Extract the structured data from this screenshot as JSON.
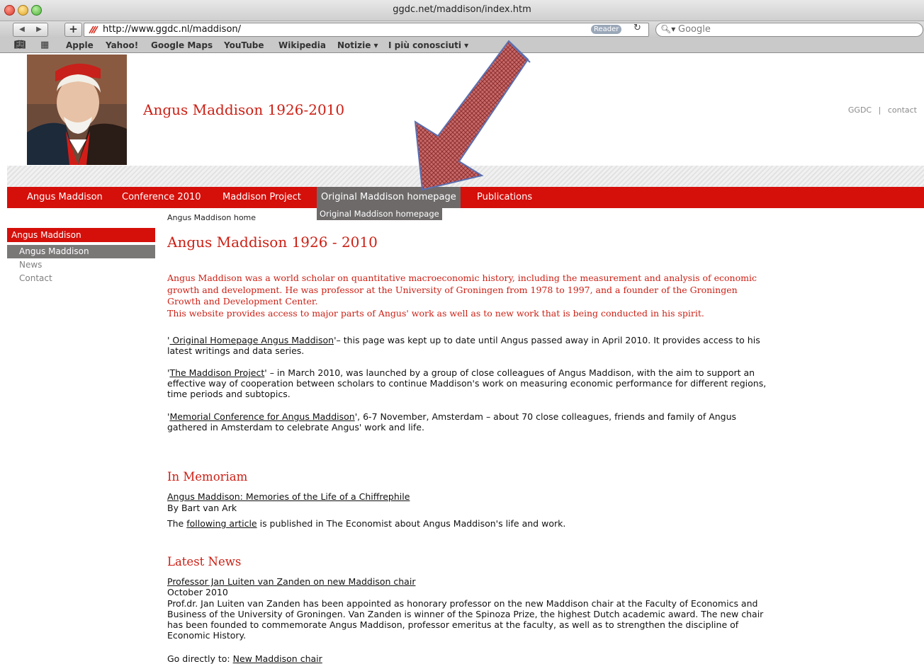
{
  "browser": {
    "window_title": "ggdc.net/maddison/index.htm",
    "url": "http://www.ggdc.nl/maddison/",
    "reader_label": "Reader",
    "search_placeholder": "Google",
    "bookmarks": [
      "Apple",
      "Yahoo!",
      "Google Maps",
      "YouTube",
      "Wikipedia",
      "Notizie ▾",
      "I più conosciuti ▾"
    ]
  },
  "header": {
    "site_title": "Angus Maddison 1926-2010",
    "top_links": [
      "GGDC",
      "contact"
    ],
    "separator": "|"
  },
  "nav": {
    "items": [
      "Angus Maddison",
      "Conference 2010",
      "Maddison Project",
      "Original Maddison homepage",
      "Publications"
    ],
    "active_submenu": "Original Maddison homepage"
  },
  "sidebar": {
    "heading": "Angus Maddison",
    "active_item": "Angus Maddison",
    "items": [
      "News",
      "Contact"
    ]
  },
  "main": {
    "breadcrumb": "Angus Maddison home",
    "title": "Angus Maddison 1926 - 2010",
    "intro_1": "Angus Maddison was a world scholar on quantitative macroeconomic history, including the measurement and analysis of economic growth and development. He was professor at the University of Groningen from 1978 to 1997, and a founder of the Groningen Growth and Development Center.",
    "intro_2": "This website provides access to major parts of Angus' work as well as to new work that is being conducted in his spirit.",
    "p1_link": " Original Homepage Angus Maddison",
    "p1_text": "– this page was kept up to date until Angus passed away in April 2010. It provides access to his latest writings and data series.",
    "p2_link": "The Maddison Project",
    "p2_text": " – in March 2010, was launched by a group of close colleagues of Angus Maddison, with the aim to support an effective way of cooperation between scholars to continue Maddison's work on measuring economic performance for different regions, time periods and subtopics.",
    "p3_link": "Memorial Conference for Angus Maddison",
    "p3_text": ", 6-7 November, Amsterdam – about 70 close colleagues, friends and family of Angus gathered in Amsterdam to celebrate Angus' work and life.",
    "memoriam": {
      "heading": "In Memoriam",
      "article_link": "Angus Maddison: Memories of the Life of a Chiffrephile",
      "byline": "By Bart van Ark",
      "economist_prefix": "The ",
      "economist_link": "following article",
      "economist_suffix": " is published in The Economist about Angus Maddison's life and work."
    },
    "news": {
      "heading": "Latest News",
      "item_link": "Professor Jan Luiten van Zanden on new Maddison chair",
      "date": "October 2010",
      "body": "Prof.dr. Jan Luiten van Zanden has been appointed as honorary professor on the new Maddison chair at the Faculty of Economics and Business of the University of Groningen. Van Zanden is winner of the Spinoza Prize, the highest Dutch academic award. The new chair has been founded to commemorate Angus Maddison, professor emeritus at the faculty, as well as to strengthen the discipline of Economic History.",
      "go_prefix": "Go directly to: ",
      "go_link": "New Maddison chair"
    }
  }
}
